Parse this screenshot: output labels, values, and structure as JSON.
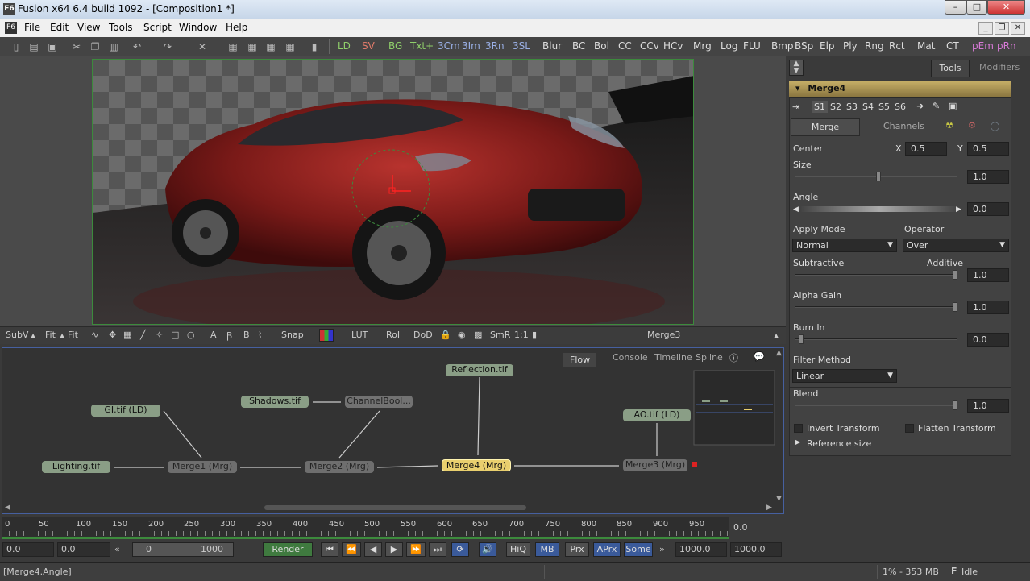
{
  "window": {
    "title": "Fusion x64 6.4 build 1092 - [Composition1 *]",
    "app_icon": "F6"
  },
  "menu": [
    "File",
    "Edit",
    "View",
    "Tools",
    "Script",
    "Window",
    "Help"
  ],
  "toolbar_tools": [
    "LD",
    "SV",
    "BG",
    "Txt+",
    "3Cm",
    "3Im",
    "3Rn",
    "3SL",
    "Blur",
    "BC",
    "Bol",
    "CC",
    "CCv",
    "HCv",
    "Mrg",
    "Log",
    "FLU",
    "Bmp",
    "BSp",
    "Elp",
    "Ply",
    "Rng",
    "Rct",
    "Mat",
    "CT",
    "pEm",
    "pRn"
  ],
  "viewer_bar": {
    "subv": "SubV",
    "fit1": "Fit",
    "fit2": "Fit",
    "snap": "Snap",
    "lut": "LUT",
    "roi": "RoI",
    "dod": "DoD",
    "smr": "SmR",
    "ratio": "1:1",
    "view_name": "Merge3"
  },
  "flow": {
    "tabs": [
      "Flow",
      "Console",
      "Timeline",
      "Spline"
    ],
    "nodes": {
      "gi": "GI.tif  (LD)",
      "lighting": "Lighting.tif",
      "shadows": "Shadows.tif",
      "channelbool": "ChannelBool...",
      "reflection": "Reflection.tif",
      "ao": "AO.tif  (LD)",
      "merge1": "Merge1  (Mrg)",
      "merge2": "Merge2  (Mrg)",
      "merge4": "Merge4  (Mrg)",
      "merge3": "Merge3  (Mrg)"
    }
  },
  "timeline": {
    "ticks": [
      "0",
      "50",
      "100",
      "150",
      "200",
      "250",
      "300",
      "350",
      "400",
      "450",
      "500",
      "550",
      "600",
      "650",
      "700",
      "750",
      "800",
      "850",
      "900",
      "950"
    ],
    "current": "0.0"
  },
  "transport": {
    "start": "0.0",
    "render_start": "0.0",
    "range_start": "0",
    "range_end": "1000",
    "render_label": "Render",
    "hiq": "HiQ",
    "mb": "MB",
    "prx": "Prx",
    "aprx": "APrx",
    "some": "Some",
    "end1": "1000.0",
    "end2": "1000.0"
  },
  "status": {
    "left": "[Merge4.Angle]",
    "mem": "1% - 353 MB",
    "state": "Idle"
  },
  "panel": {
    "tabs": [
      "Tools",
      "Modifiers"
    ],
    "tool_name": "Merge4",
    "slots": [
      "S1",
      "S2",
      "S3",
      "S4",
      "S5",
      "S6"
    ],
    "subtabs": [
      "Merge",
      "Channels"
    ],
    "center_label": "Center",
    "x_label": "X",
    "x_val": "0.5",
    "y_label": "Y",
    "y_val": "0.5",
    "size_label": "Size",
    "size_val": "1.0",
    "angle_label": "Angle",
    "angle_val": "0.0",
    "apply_mode_label": "Apply Mode",
    "apply_mode_val": "Normal",
    "operator_label": "Operator",
    "operator_val": "Over",
    "subtractive_label": "Subtractive",
    "additive_label": "Additive",
    "subadd_val": "1.0",
    "alpha_gain_label": "Alpha Gain",
    "alpha_gain_val": "1.0",
    "burn_in_label": "Burn In",
    "burn_in_val": "0.0",
    "filter_label": "Filter Method",
    "filter_val": "Linear",
    "blend_label": "Blend",
    "blend_val": "1.0",
    "invert_label": "Invert Transform",
    "flatten_label": "Flatten Transform",
    "refsize_label": "Reference size"
  }
}
